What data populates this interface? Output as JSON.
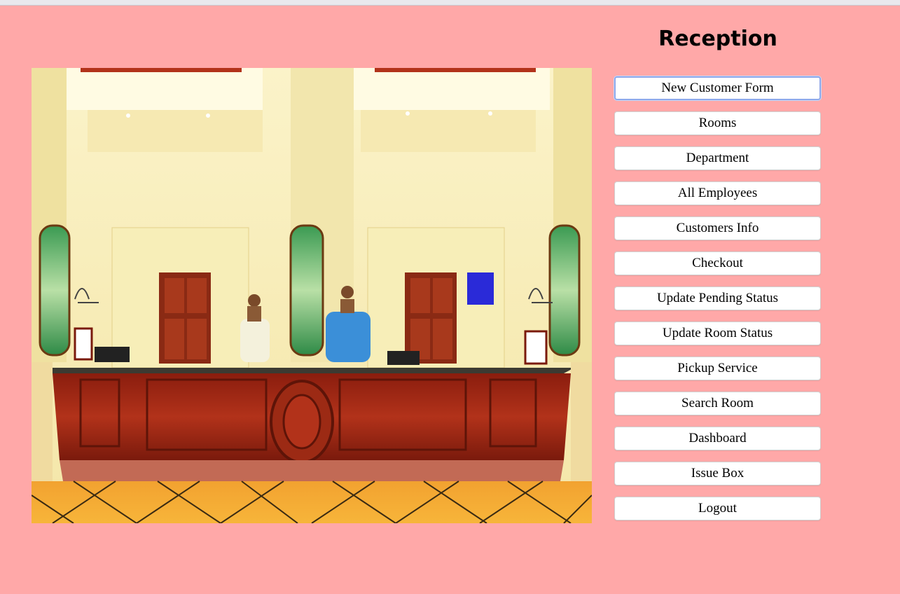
{
  "page": {
    "title": "Reception",
    "background_color": "#ffa8a8"
  },
  "photo": {
    "description_icon": "hotel-reception-photo"
  },
  "menu": {
    "focused_index": 0,
    "items": [
      {
        "label": "New Customer Form"
      },
      {
        "label": "Rooms"
      },
      {
        "label": "Department"
      },
      {
        "label": "All Employees"
      },
      {
        "label": "Customers Info"
      },
      {
        "label": "Checkout"
      },
      {
        "label": "Update Pending Status"
      },
      {
        "label": "Update Room Status"
      },
      {
        "label": "Pickup Service"
      },
      {
        "label": "Search Room"
      },
      {
        "label": "Dashboard"
      },
      {
        "label": "Issue Box"
      },
      {
        "label": "Logout"
      }
    ]
  }
}
